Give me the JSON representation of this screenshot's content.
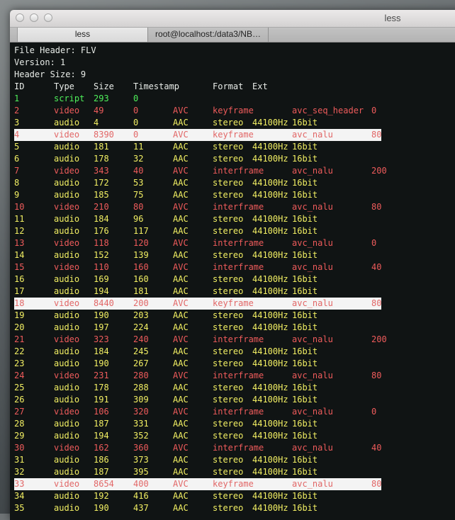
{
  "window": {
    "title": "less",
    "tabs": [
      {
        "label": "less"
      },
      {
        "label": "root@localhost:/data3/NB…"
      }
    ]
  },
  "header": {
    "lines": [
      "File Header: FLV",
      "Version: 1",
      "Header Size: 9"
    ],
    "columns": [
      "ID",
      "Type",
      "Size",
      "Timestamp",
      "Format",
      "Ext"
    ]
  },
  "rows": [
    {
      "id": "1",
      "type": "script",
      "size": "293",
      "ts": "0",
      "codec": "",
      "fmt": "",
      "rate": "",
      "ext": "",
      "val": "",
      "hl": false
    },
    {
      "id": "2",
      "type": "video",
      "size": "49",
      "ts": "0",
      "codec": "AVC",
      "fmt": "keyframe",
      "rate": "",
      "ext": "avc_seq_header",
      "val": "0",
      "hl": false
    },
    {
      "id": "3",
      "type": "audio",
      "size": "4",
      "ts": "0",
      "codec": "AAC",
      "fmt": "stereo",
      "rate": "44100Hz",
      "ext": "16bit",
      "val": "",
      "hl": false
    },
    {
      "id": "4",
      "type": "video",
      "size": "8390",
      "ts": "0",
      "codec": "AVC",
      "fmt": "keyframe",
      "rate": "",
      "ext": "avc_nalu",
      "val": "80",
      "hl": true
    },
    {
      "id": "5",
      "type": "audio",
      "size": "181",
      "ts": "11",
      "codec": "AAC",
      "fmt": "stereo",
      "rate": "44100Hz",
      "ext": "16bit",
      "val": "",
      "hl": false
    },
    {
      "id": "6",
      "type": "audio",
      "size": "178",
      "ts": "32",
      "codec": "AAC",
      "fmt": "stereo",
      "rate": "44100Hz",
      "ext": "16bit",
      "val": "",
      "hl": false
    },
    {
      "id": "7",
      "type": "video",
      "size": "343",
      "ts": "40",
      "codec": "AVC",
      "fmt": "interframe",
      "rate": "",
      "ext": "avc_nalu",
      "val": "200",
      "hl": false
    },
    {
      "id": "8",
      "type": "audio",
      "size": "172",
      "ts": "53",
      "codec": "AAC",
      "fmt": "stereo",
      "rate": "44100Hz",
      "ext": "16bit",
      "val": "",
      "hl": false
    },
    {
      "id": "9",
      "type": "audio",
      "size": "185",
      "ts": "75",
      "codec": "AAC",
      "fmt": "stereo",
      "rate": "44100Hz",
      "ext": "16bit",
      "val": "",
      "hl": false
    },
    {
      "id": "10",
      "type": "video",
      "size": "210",
      "ts": "80",
      "codec": "AVC",
      "fmt": "interframe",
      "rate": "",
      "ext": "avc_nalu",
      "val": "80",
      "hl": false
    },
    {
      "id": "11",
      "type": "audio",
      "size": "184",
      "ts": "96",
      "codec": "AAC",
      "fmt": "stereo",
      "rate": "44100Hz",
      "ext": "16bit",
      "val": "",
      "hl": false
    },
    {
      "id": "12",
      "type": "audio",
      "size": "176",
      "ts": "117",
      "codec": "AAC",
      "fmt": "stereo",
      "rate": "44100Hz",
      "ext": "16bit",
      "val": "",
      "hl": false
    },
    {
      "id": "13",
      "type": "video",
      "size": "118",
      "ts": "120",
      "codec": "AVC",
      "fmt": "interframe",
      "rate": "",
      "ext": "avc_nalu",
      "val": "0",
      "hl": false
    },
    {
      "id": "14",
      "type": "audio",
      "size": "152",
      "ts": "139",
      "codec": "AAC",
      "fmt": "stereo",
      "rate": "44100Hz",
      "ext": "16bit",
      "val": "",
      "hl": false
    },
    {
      "id": "15",
      "type": "video",
      "size": "110",
      "ts": "160",
      "codec": "AVC",
      "fmt": "interframe",
      "rate": "",
      "ext": "avc_nalu",
      "val": "40",
      "hl": false
    },
    {
      "id": "16",
      "type": "audio",
      "size": "169",
      "ts": "160",
      "codec": "AAC",
      "fmt": "stereo",
      "rate": "44100Hz",
      "ext": "16bit",
      "val": "",
      "hl": false
    },
    {
      "id": "17",
      "type": "audio",
      "size": "194",
      "ts": "181",
      "codec": "AAC",
      "fmt": "stereo",
      "rate": "44100Hz",
      "ext": "16bit",
      "val": "",
      "hl": false
    },
    {
      "id": "18",
      "type": "video",
      "size": "8440",
      "ts": "200",
      "codec": "AVC",
      "fmt": "keyframe",
      "rate": "",
      "ext": "avc_nalu",
      "val": "80",
      "hl": true
    },
    {
      "id": "19",
      "type": "audio",
      "size": "190",
      "ts": "203",
      "codec": "AAC",
      "fmt": "stereo",
      "rate": "44100Hz",
      "ext": "16bit",
      "val": "",
      "hl": false
    },
    {
      "id": "20",
      "type": "audio",
      "size": "197",
      "ts": "224",
      "codec": "AAC",
      "fmt": "stereo",
      "rate": "44100Hz",
      "ext": "16bit",
      "val": "",
      "hl": false
    },
    {
      "id": "21",
      "type": "video",
      "size": "323",
      "ts": "240",
      "codec": "AVC",
      "fmt": "interframe",
      "rate": "",
      "ext": "avc_nalu",
      "val": "200",
      "hl": false
    },
    {
      "id": "22",
      "type": "audio",
      "size": "184",
      "ts": "245",
      "codec": "AAC",
      "fmt": "stereo",
      "rate": "44100Hz",
      "ext": "16bit",
      "val": "",
      "hl": false
    },
    {
      "id": "23",
      "type": "audio",
      "size": "190",
      "ts": "267",
      "codec": "AAC",
      "fmt": "stereo",
      "rate": "44100Hz",
      "ext": "16bit",
      "val": "",
      "hl": false
    },
    {
      "id": "24",
      "type": "video",
      "size": "231",
      "ts": "280",
      "codec": "AVC",
      "fmt": "interframe",
      "rate": "",
      "ext": "avc_nalu",
      "val": "80",
      "hl": false
    },
    {
      "id": "25",
      "type": "audio",
      "size": "178",
      "ts": "288",
      "codec": "AAC",
      "fmt": "stereo",
      "rate": "44100Hz",
      "ext": "16bit",
      "val": "",
      "hl": false
    },
    {
      "id": "26",
      "type": "audio",
      "size": "191",
      "ts": "309",
      "codec": "AAC",
      "fmt": "stereo",
      "rate": "44100Hz",
      "ext": "16bit",
      "val": "",
      "hl": false
    },
    {
      "id": "27",
      "type": "video",
      "size": "106",
      "ts": "320",
      "codec": "AVC",
      "fmt": "interframe",
      "rate": "",
      "ext": "avc_nalu",
      "val": "0",
      "hl": false
    },
    {
      "id": "28",
      "type": "audio",
      "size": "187",
      "ts": "331",
      "codec": "AAC",
      "fmt": "stereo",
      "rate": "44100Hz",
      "ext": "16bit",
      "val": "",
      "hl": false
    },
    {
      "id": "29",
      "type": "audio",
      "size": "194",
      "ts": "352",
      "codec": "AAC",
      "fmt": "stereo",
      "rate": "44100Hz",
      "ext": "16bit",
      "val": "",
      "hl": false
    },
    {
      "id": "30",
      "type": "video",
      "size": "162",
      "ts": "360",
      "codec": "AVC",
      "fmt": "interframe",
      "rate": "",
      "ext": "avc_nalu",
      "val": "40",
      "hl": false
    },
    {
      "id": "31",
      "type": "audio",
      "size": "186",
      "ts": "373",
      "codec": "AAC",
      "fmt": "stereo",
      "rate": "44100Hz",
      "ext": "16bit",
      "val": "",
      "hl": false
    },
    {
      "id": "32",
      "type": "audio",
      "size": "187",
      "ts": "395",
      "codec": "AAC",
      "fmt": "stereo",
      "rate": "44100Hz",
      "ext": "16bit",
      "val": "",
      "hl": false
    },
    {
      "id": "33",
      "type": "video",
      "size": "8654",
      "ts": "400",
      "codec": "AVC",
      "fmt": "keyframe",
      "rate": "",
      "ext": "avc_nalu",
      "val": "80",
      "hl": true
    },
    {
      "id": "34",
      "type": "audio",
      "size": "192",
      "ts": "416",
      "codec": "AAC",
      "fmt": "stereo",
      "rate": "44100Hz",
      "ext": "16bit",
      "val": "",
      "hl": false
    },
    {
      "id": "35",
      "type": "audio",
      "size": "190",
      "ts": "437",
      "codec": "AAC",
      "fmt": "stereo",
      "rate": "44100Hz",
      "ext": "16bit",
      "val": "",
      "hl": false
    }
  ]
}
